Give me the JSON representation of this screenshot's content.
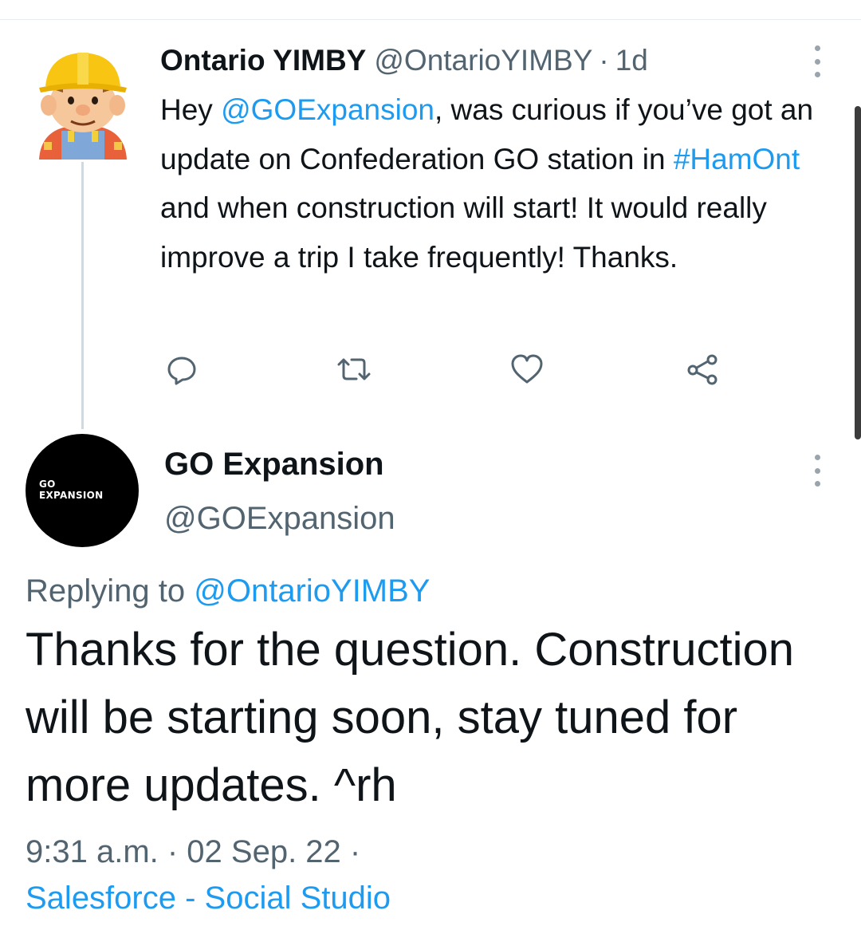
{
  "parent_tweet": {
    "author_name": "Ontario YIMBY",
    "author_handle": "@OntarioYIMBY",
    "separator": "·",
    "time_ago": "1d",
    "body": {
      "t1": "Hey ",
      "mention": "@GOExpansion",
      "t2": ", was curious if you’ve got an update on Confederation GO station in ",
      "hashtag": "#HamOnt",
      "t3": " and when construction will start! It would really improve a trip I take frequently! Thanks."
    },
    "actions": [
      "reply-icon",
      "retweet-icon",
      "like-icon",
      "share-icon"
    ]
  },
  "reply_tweet": {
    "author_name": "GO Expansion",
    "author_handle": "@GOExpansion",
    "avatar_logo_line1": "GO",
    "avatar_logo_line2": "EXPANSION",
    "replying_prefix": "Replying to ",
    "replying_handle": "@OntarioYIMBY",
    "body": "Thanks for the question. Construction will be starting soon, stay tuned for more updates. ^rh",
    "timestamp": "9:31 a.m. · 02 Sep. 22 ·",
    "source": "Salesforce - Social Studio"
  },
  "colors": {
    "link": "#1d9bf0",
    "secondary_text": "#536471",
    "primary_text": "#0f1419",
    "avatar_go_bg": "#000000"
  }
}
